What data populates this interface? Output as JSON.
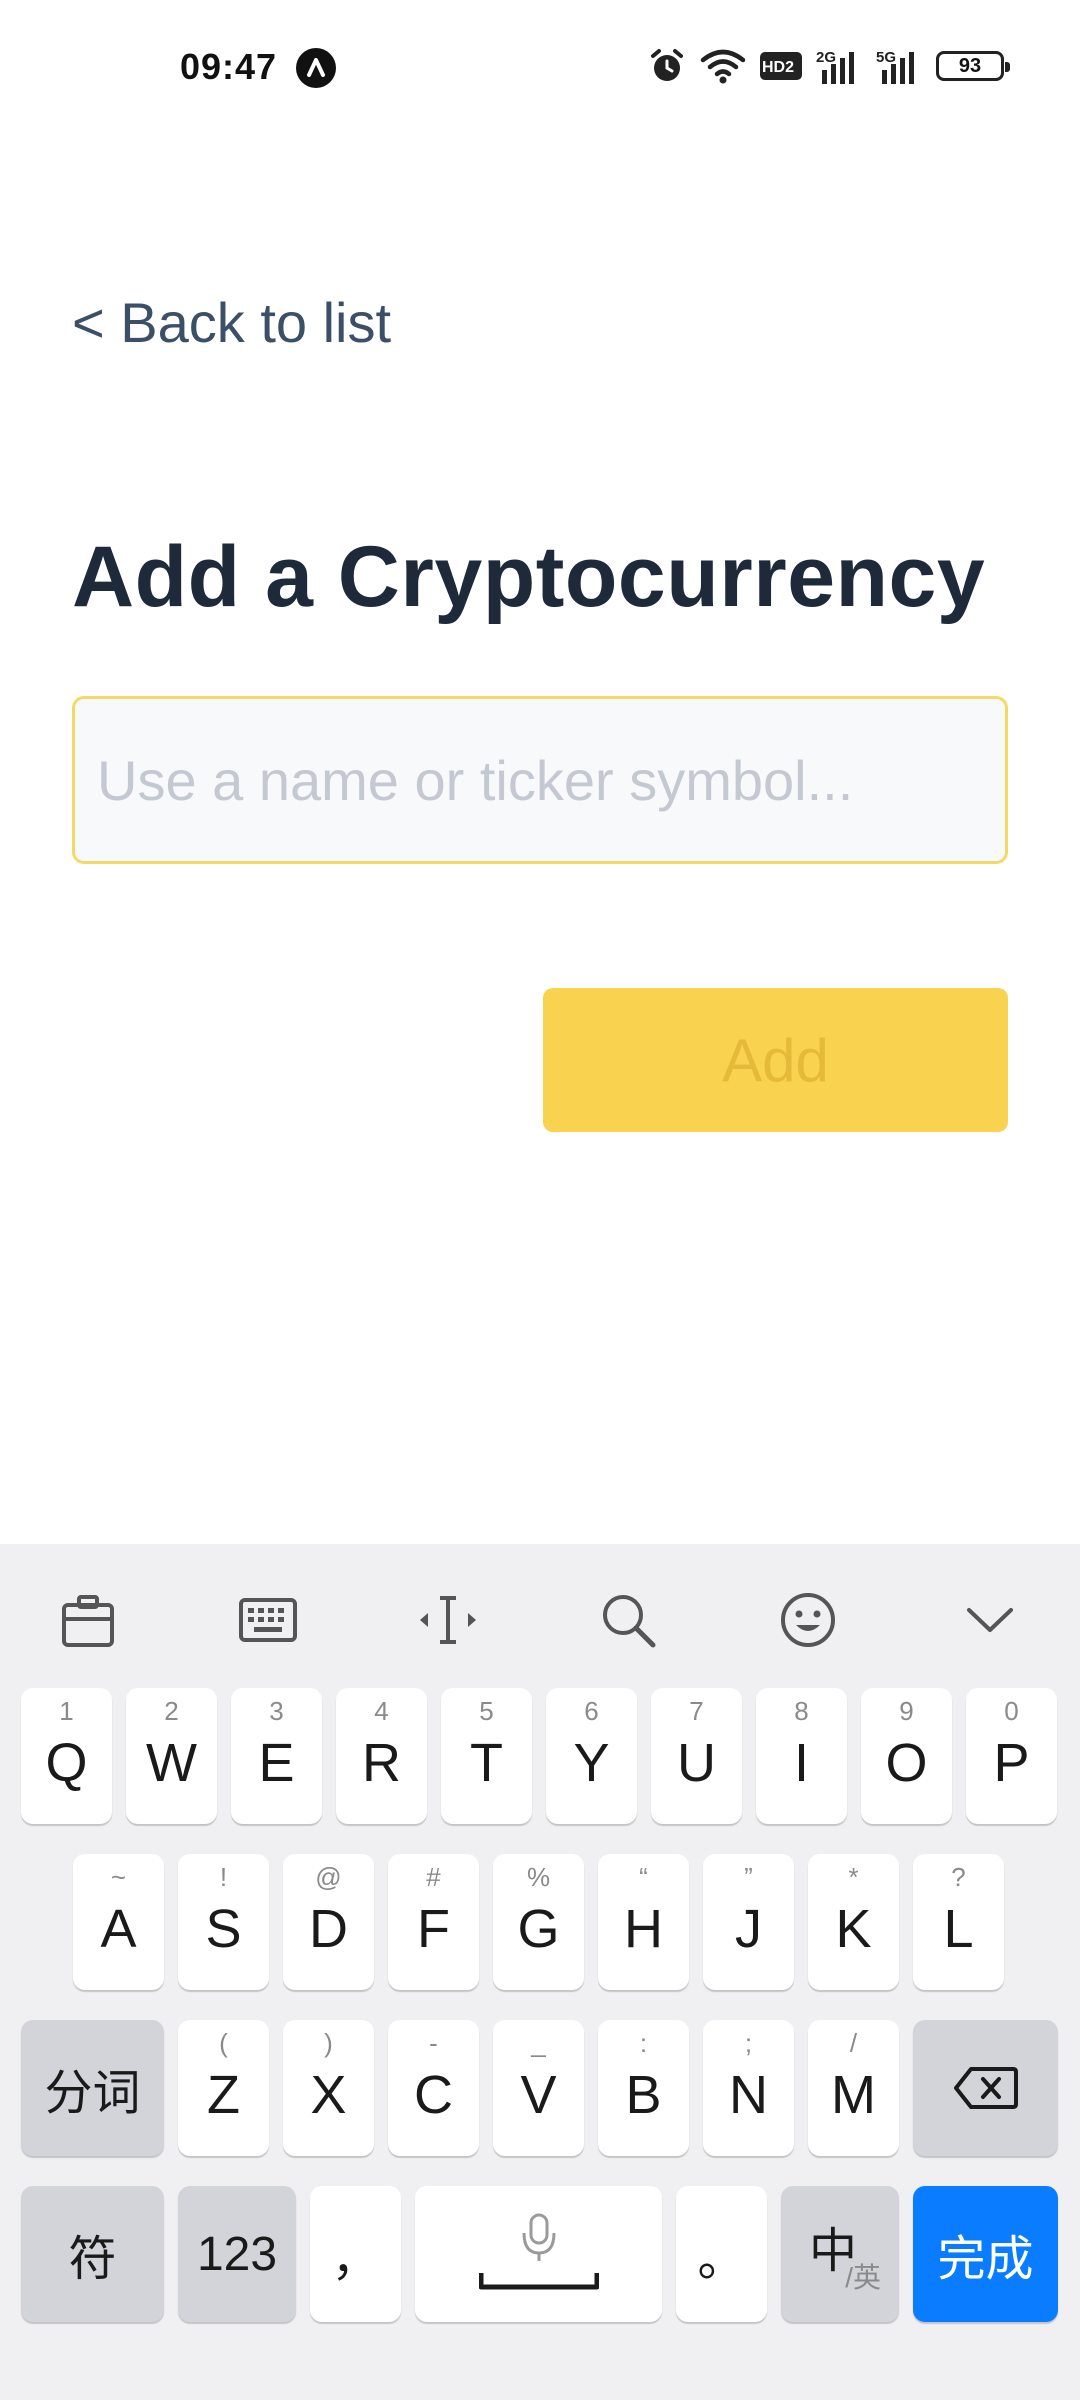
{
  "status_bar": {
    "time": "09:47",
    "network_labels": [
      "HD2",
      "2G",
      "5G"
    ],
    "battery": "93",
    "icons": [
      "app-notification-icon",
      "alarm-icon",
      "wifi-icon",
      "hd-voice-icon",
      "signal-2g-icon",
      "signal-5g-icon",
      "battery-icon"
    ]
  },
  "nav": {
    "back_label": "< Back to list"
  },
  "page": {
    "title": "Add a Cryptocurrency"
  },
  "search": {
    "placeholder": "Use a name or ticker symbol...",
    "value": ""
  },
  "actions": {
    "add_label": "Add"
  },
  "colors": {
    "accent_yellow": "#F9D250",
    "input_border": "#F3DA66",
    "title": "#1E2939",
    "back_link": "#3B5068",
    "keyboard_bg": "#F0F0F2",
    "done_key": "#0A7CFF"
  },
  "keyboard": {
    "toolbar_icons": [
      "clipboard-icon",
      "keyboard-icon",
      "cursor-move-icon",
      "search-icon",
      "emoji-icon",
      "collapse-chevron-icon"
    ],
    "row1": [
      {
        "main": "Q",
        "sup": "1"
      },
      {
        "main": "W",
        "sup": "2"
      },
      {
        "main": "E",
        "sup": "3"
      },
      {
        "main": "R",
        "sup": "4"
      },
      {
        "main": "T",
        "sup": "5"
      },
      {
        "main": "Y",
        "sup": "6"
      },
      {
        "main": "U",
        "sup": "7"
      },
      {
        "main": "I",
        "sup": "8"
      },
      {
        "main": "O",
        "sup": "9"
      },
      {
        "main": "P",
        "sup": "0"
      }
    ],
    "row2": [
      {
        "main": "A",
        "sup": "~"
      },
      {
        "main": "S",
        "sup": "!"
      },
      {
        "main": "D",
        "sup": "@"
      },
      {
        "main": "F",
        "sup": "#"
      },
      {
        "main": "G",
        "sup": "%"
      },
      {
        "main": "H",
        "sup": "“"
      },
      {
        "main": "J",
        "sup": "”"
      },
      {
        "main": "K",
        "sup": "*"
      },
      {
        "main": "L",
        "sup": "?"
      }
    ],
    "row3_left": "分词",
    "row3": [
      {
        "main": "Z",
        "sup": "("
      },
      {
        "main": "X",
        "sup": ")"
      },
      {
        "main": "C",
        "sup": "-"
      },
      {
        "main": "V",
        "sup": "_"
      },
      {
        "main": "B",
        "sup": ":"
      },
      {
        "main": "N",
        "sup": ";"
      },
      {
        "main": "M",
        "sup": "/"
      }
    ],
    "bottom": {
      "symbols": "符",
      "numbers": "123",
      "comma": "，",
      "period": "。",
      "lang_main": "中",
      "lang_sub": "/英",
      "done": "完成"
    }
  }
}
